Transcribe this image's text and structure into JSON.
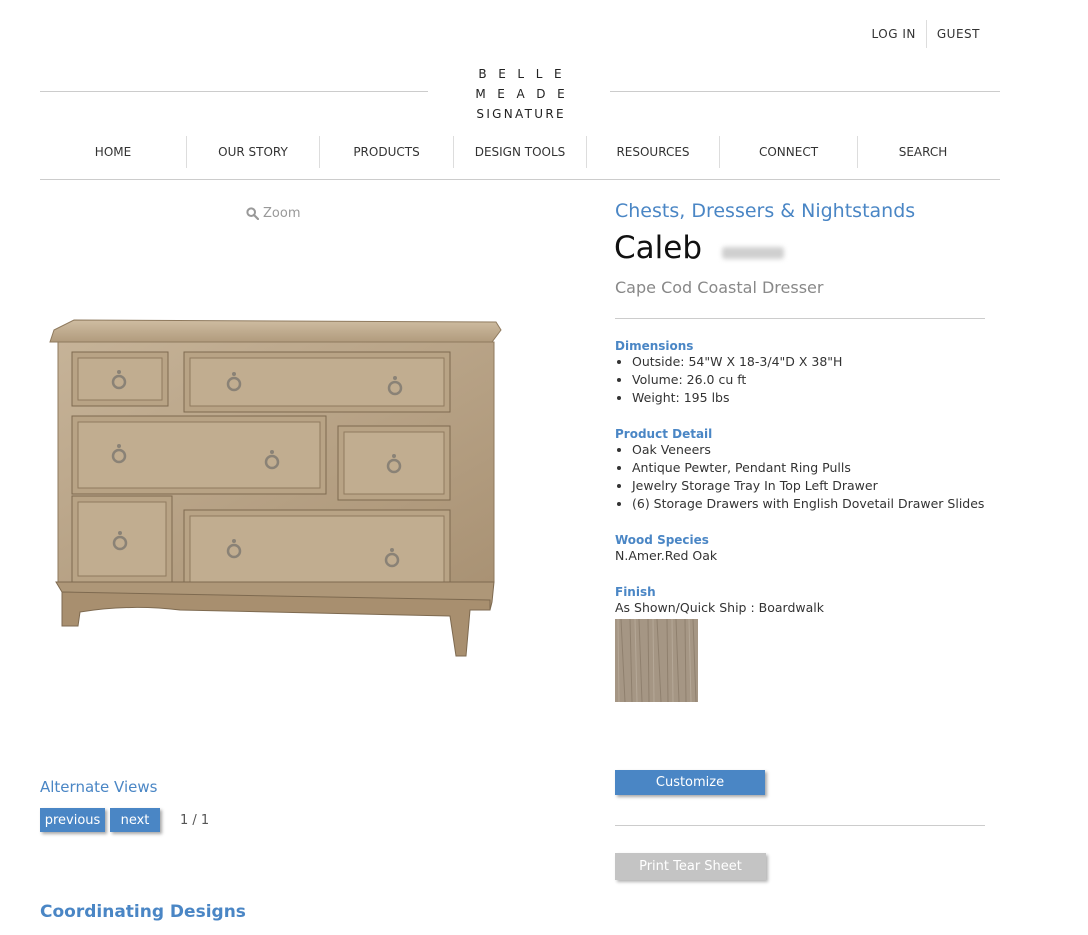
{
  "header": {
    "login_label": "LOG IN",
    "guest_label": "GUEST",
    "logo": [
      "BELLE",
      "MEADE",
      "SIGNATURE"
    ]
  },
  "nav": {
    "items": [
      "HOME",
      "OUR STORY",
      "PRODUCTS",
      "DESIGN TOOLS",
      "RESOURCES",
      "CONNECT",
      "SEARCH"
    ]
  },
  "gallery": {
    "zoom_label": "Zoom",
    "alt_views_label": "Alternate Views",
    "previous_label": "previous",
    "next_label": "next",
    "pager_text": "1 / 1",
    "image_icon": "dresser-image"
  },
  "product": {
    "category": "Chests, Dressers & Nightstands",
    "name": "Caleb",
    "subtitle": "Cape Cod Coastal Dresser",
    "dimensions_title": "Dimensions",
    "dimensions": [
      "Outside: 54\"W X 18-3/4\"D X 38\"H",
      "Volume: 26.0 cu ft",
      "Weight: 195 lbs"
    ],
    "detail_title": "Product Detail",
    "details": [
      "Oak Veneers",
      "Antique Pewter, Pendant Ring Pulls",
      "Jewelry Storage Tray In Top Left Drawer",
      "(6) Storage Drawers with English Dovetail Drawer Slides"
    ],
    "wood_title": "Wood Species",
    "wood_value": "N.Amer.Red Oak",
    "finish_title": "Finish",
    "finish_value": "As Shown/Quick Ship : Boardwalk",
    "customize_label": "Customize",
    "print_label": "Print Tear Sheet"
  },
  "coordinating_title": "Coordinating Designs",
  "colors": {
    "accent": "#4a86c5",
    "wood": "#b9a589",
    "disabled_button": "#c4c4c4"
  }
}
